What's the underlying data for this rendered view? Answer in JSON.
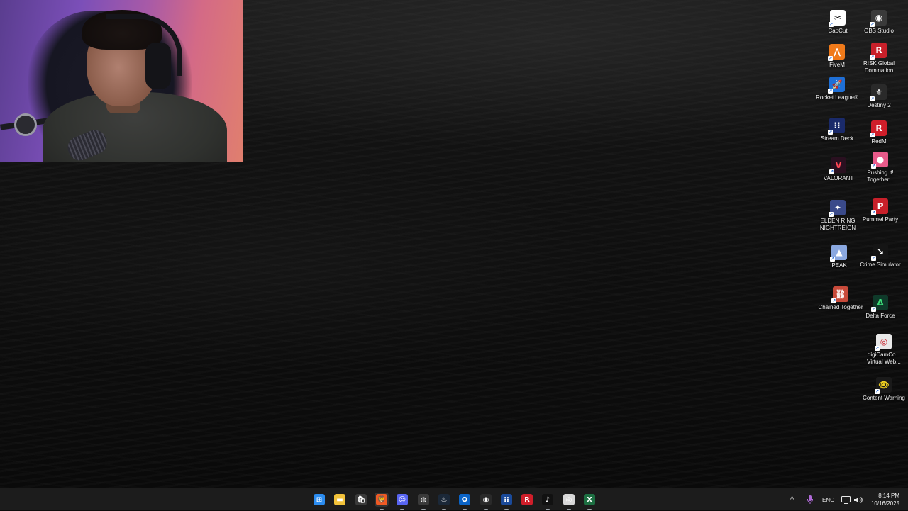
{
  "desktop_icons": [
    {
      "label": "CapCut",
      "icon": "capcut-icon",
      "color": "#ffffff",
      "fg": "#000000",
      "glyph": "✂"
    },
    {
      "label": "OBS Studio",
      "icon": "obs-icon",
      "color": "#3a3a3a",
      "fg": "#ffffff",
      "glyph": "◉"
    },
    {
      "label": "FiveM",
      "icon": "fivem-icon",
      "color": "#f07a1a",
      "fg": "#ffffff",
      "glyph": "⋀"
    },
    {
      "label": "RISK Global Domination",
      "icon": "risk-icon",
      "color": "#c8202a",
      "fg": "#ffffff",
      "glyph": "R"
    },
    {
      "label": "Rocket League®",
      "icon": "rocket-league-icon",
      "color": "#1e6fd6",
      "fg": "#ffffff",
      "glyph": "🚀"
    },
    {
      "label": "Destiny 2",
      "icon": "destiny-icon",
      "color": "#2a2a2a",
      "fg": "#ffffff",
      "glyph": "⚜"
    },
    {
      "label": "Stream Deck",
      "icon": "stream-deck-icon",
      "color": "#1a2a6a",
      "fg": "#ffffff",
      "glyph": "⁝⁝"
    },
    {
      "label": "RedM",
      "icon": "redm-icon",
      "color": "#d01e2a",
      "fg": "#ffffff",
      "glyph": "R"
    },
    {
      "label": "VALORANT",
      "icon": "valorant-icon",
      "color": "#2a1020",
      "fg": "#ff4655",
      "glyph": "V"
    },
    {
      "label": "Pushing it! Together...",
      "icon": "pushing-it-icon",
      "color": "#e85a8a",
      "fg": "#ffffff",
      "glyph": "●"
    },
    {
      "label": "ELDEN RING NIGHTREIGN",
      "icon": "elden-ring-icon",
      "color": "#3a4a8a",
      "fg": "#ffffff",
      "glyph": "✦"
    },
    {
      "label": "Pummel Party",
      "icon": "pummel-party-icon",
      "color": "#c8202a",
      "fg": "#ffffff",
      "glyph": "P"
    },
    {
      "label": "PEAK",
      "icon": "peak-icon",
      "color": "#8aa8e0",
      "fg": "#ffffff",
      "glyph": "▲"
    },
    {
      "label": "Crime Simulator",
      "icon": "crime-simulator-icon",
      "color": "#151515",
      "fg": "#ffffff",
      "glyph": "↘"
    },
    {
      "label": "Chained Together",
      "icon": "chained-together-icon",
      "color": "#c84a3a",
      "fg": "#ffffff",
      "glyph": "⛓"
    },
    {
      "label": "Delta Force",
      "icon": "delta-force-icon",
      "color": "#0f3a2a",
      "fg": "#3ee07a",
      "glyph": "Δ"
    },
    {
      "label": "digiCamCo... Virtual Web...",
      "icon": "digicam-icon",
      "color": "#e8e8e8",
      "fg": "#c8202a",
      "glyph": "◎"
    },
    {
      "label": "Content Warning",
      "icon": "content-warning-icon",
      "color": "#1a1a1a",
      "fg": "#f0d020",
      "glyph": "👁"
    }
  ],
  "taskbar": {
    "apps": [
      {
        "name": "start-button",
        "icon": "windows-icon",
        "color": "#2b8cf0",
        "glyph": "⊞"
      },
      {
        "name": "file-explorer",
        "icon": "folder-icon",
        "color": "#f2c23a",
        "glyph": "▬"
      },
      {
        "name": "microsoft-store",
        "icon": "store-icon",
        "color": "#3a3a3a",
        "glyph": "🛍"
      },
      {
        "name": "brave-browser",
        "icon": "brave-icon",
        "color": "#f05a24",
        "glyph": "🦁"
      },
      {
        "name": "discord",
        "icon": "discord-icon",
        "color": "#5865f2",
        "glyph": "☺"
      },
      {
        "name": "chrome-like-app",
        "icon": "globe-icon",
        "color": "#3a3a3a",
        "glyph": "◍"
      },
      {
        "name": "steam",
        "icon": "steam-icon",
        "color": "#1b2838",
        "glyph": "♨"
      },
      {
        "name": "outlook",
        "icon": "outlook-icon",
        "color": "#0a64c8",
        "glyph": "O"
      },
      {
        "name": "obs-taskbar",
        "icon": "obs-icon",
        "color": "#2a2a2a",
        "glyph": "◉"
      },
      {
        "name": "stream-deck-taskbar",
        "icon": "stream-deck-icon",
        "color": "#1a4a9a",
        "glyph": "⁝⁝"
      },
      {
        "name": "riot-app",
        "icon": "riot-icon",
        "color": "#d01e2a",
        "glyph": "R"
      },
      {
        "name": "tiktok",
        "icon": "tiktok-icon",
        "color": "#111111",
        "glyph": "♪"
      },
      {
        "name": "digicam-taskbar",
        "icon": "digicam-icon",
        "color": "#d8d8d8",
        "glyph": "◎"
      },
      {
        "name": "excel-app",
        "icon": "excel-icon",
        "color": "#1d6f42",
        "glyph": "X"
      }
    ],
    "tray": {
      "chevron": "^",
      "mic_icon": "microphone-icon",
      "language": "ENG",
      "network_icon": "network-icon",
      "volume_icon": "speaker-icon",
      "time": "8:14 PM",
      "date": "10/16/2025"
    }
  }
}
